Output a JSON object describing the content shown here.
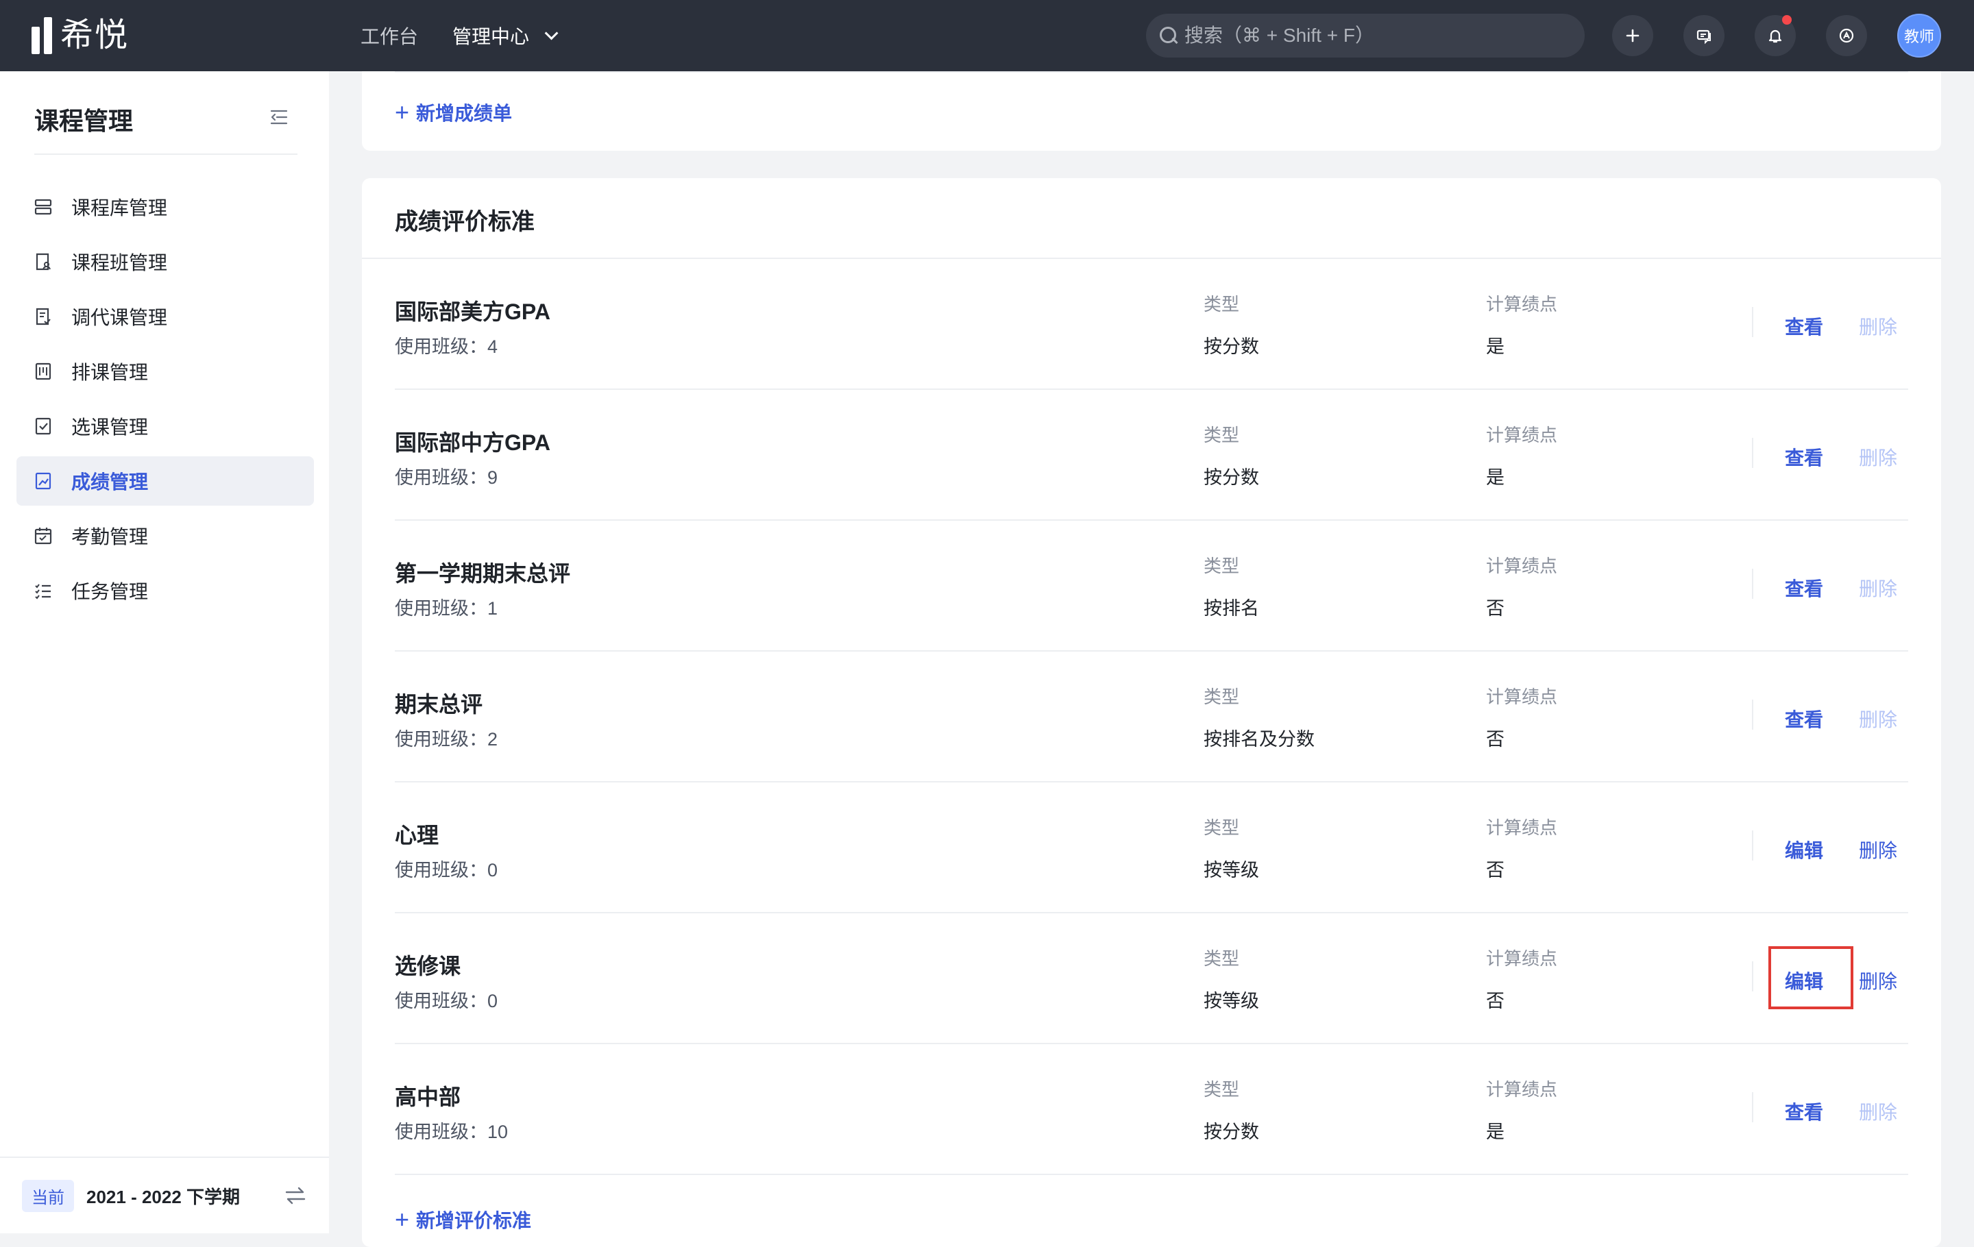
{
  "app": {
    "brand": "希悦"
  },
  "topnav": {
    "items": [
      {
        "label": "工作台",
        "active": false
      },
      {
        "label": "管理中心",
        "active": true
      }
    ]
  },
  "search": {
    "placeholder": "搜索（⌘ + Shift + F）"
  },
  "header_icons": [
    "plus-icon",
    "chat-icon",
    "bell-icon",
    "help-icon"
  ],
  "user": {
    "avatar_text": "教师"
  },
  "sidebar": {
    "title": "课程管理",
    "items": [
      {
        "label": "课程库管理",
        "icon": "stack-icon"
      },
      {
        "label": "课程班管理",
        "icon": "class-icon"
      },
      {
        "label": "调代课管理",
        "icon": "substitute-icon"
      },
      {
        "label": "排课管理",
        "icon": "schedule-icon"
      },
      {
        "label": "选课管理",
        "icon": "checkbox-icon"
      },
      {
        "label": "成绩管理",
        "icon": "grade-icon",
        "active": true
      },
      {
        "label": "考勤管理",
        "icon": "calendar-icon"
      },
      {
        "label": "任务管理",
        "icon": "tasklist-icon"
      }
    ],
    "footer": {
      "tag": "当前",
      "term": "2021 - 2022 下学期"
    }
  },
  "main": {
    "add_gradebook_label": "新增成绩单",
    "section_title": "成绩评价标准",
    "col_type_label": "类型",
    "col_gpa_label": "计算绩点",
    "view_label": "查看",
    "edit_label": "编辑",
    "delete_label": "删除",
    "count_prefix": "使用班级：",
    "rows": [
      {
        "name": "国际部美方GPA",
        "count": "4",
        "type": "按分数",
        "gpa": "是",
        "action": "查看",
        "delete_enabled": false
      },
      {
        "name": "国际部中方GPA",
        "count": "9",
        "type": "按分数",
        "gpa": "是",
        "action": "查看",
        "delete_enabled": false
      },
      {
        "name": "第一学期期末总评",
        "count": "1",
        "type": "按排名",
        "gpa": "否",
        "action": "查看",
        "delete_enabled": false
      },
      {
        "name": "期末总评",
        "count": "2",
        "type": "按排名及分数",
        "gpa": "否",
        "action": "查看",
        "delete_enabled": false
      },
      {
        "name": "心理",
        "count": "0",
        "type": "按等级",
        "gpa": "否",
        "action": "编辑",
        "delete_enabled": true
      },
      {
        "name": "选修课",
        "count": "0",
        "type": "按等级",
        "gpa": "否",
        "action": "编辑",
        "delete_enabled": true,
        "highlighted": true
      },
      {
        "name": "高中部",
        "count": "10",
        "type": "按分数",
        "gpa": "是",
        "action": "查看",
        "delete_enabled": false
      }
    ],
    "add_standard_label": "新增评价标准"
  },
  "colors": {
    "accent": "#3a5bd9",
    "topbar": "#2b303b",
    "highlight": "#e13b34",
    "disabled": "#b4c4f6"
  }
}
